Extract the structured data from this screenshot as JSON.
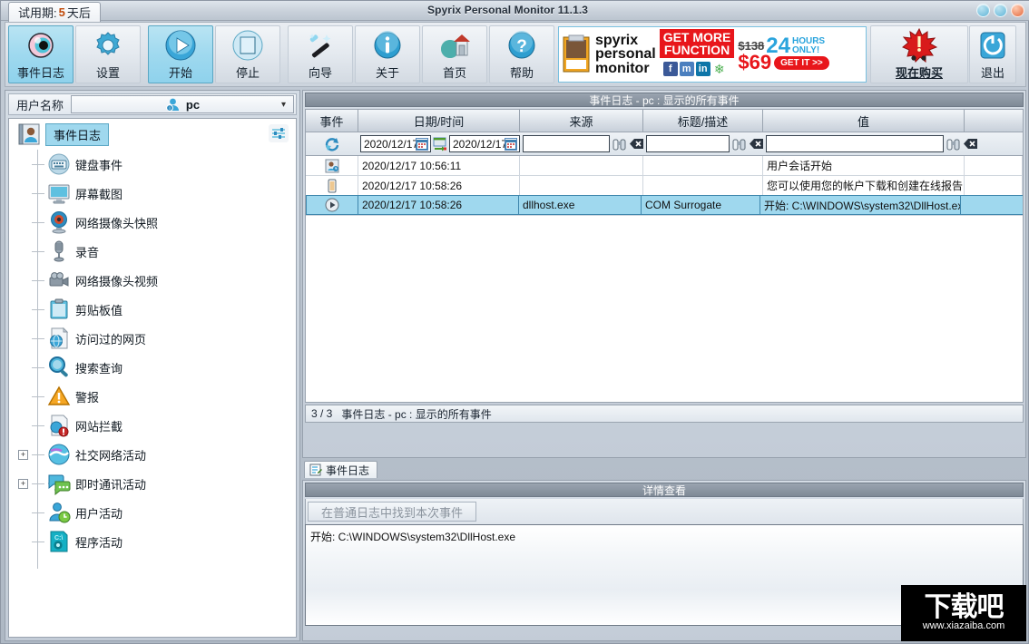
{
  "window": {
    "title": "Spyrix Personal Monitor 11.1.3",
    "trial_tab_prefix": "试用期:",
    "trial_days": "5",
    "trial_tab_suffix": "天后",
    "minimize_label": "–",
    "maximize_label": "□",
    "close_label": "×"
  },
  "toolbar": {
    "buttons": [
      {
        "label": "事件日志",
        "icon": "eye-icon",
        "selected": true
      },
      {
        "label": "设置",
        "icon": "gear-icon",
        "selected": false
      },
      {
        "label": "开始",
        "icon": "play-icon",
        "selected": true
      },
      {
        "label": "停止",
        "icon": "stop-icon",
        "selected": false
      },
      {
        "label": "向导",
        "icon": "wand-icon",
        "selected": false
      },
      {
        "label": "关于",
        "icon": "info-icon",
        "selected": false
      },
      {
        "label": "首页",
        "icon": "home-icon",
        "selected": false
      },
      {
        "label": "帮助",
        "icon": "question-icon",
        "selected": false
      }
    ],
    "buy": {
      "label": "现在购买",
      "icon": "starburst-alert-icon"
    },
    "exit": {
      "label": "退出",
      "icon": "power-icon"
    }
  },
  "banner": {
    "brand_line1": "spyrix",
    "brand_line2": "personal",
    "brand_line3": "monitor",
    "get_more_line1": "GET MORE",
    "get_more_line2": "FUNCTION",
    "old_price": "$138",
    "hours_number": "24",
    "hours_line1": "HOURS",
    "hours_line2": "ONLY!",
    "price": "$69",
    "cta": "GET IT >>",
    "socials": [
      "facebook-icon",
      "myspace-icon",
      "linkedin-icon",
      "icq-icon"
    ]
  },
  "sidebar": {
    "user_label": "用户名称",
    "user_value": "pc",
    "user_icon": "user-avatar-icon",
    "chevron": "▾",
    "filter_icon": "sliders-icon",
    "root": {
      "label": "事件日志",
      "icon": "logbook-icon"
    },
    "items": [
      {
        "label": "键盘事件",
        "icon": "keyboard-icon",
        "expandable": false
      },
      {
        "label": "屏幕截图",
        "icon": "monitor-icon",
        "expandable": false
      },
      {
        "label": "网络摄像头快照",
        "icon": "webcam-snapshot-icon",
        "expandable": false
      },
      {
        "label": "录音",
        "icon": "microphone-icon",
        "expandable": false
      },
      {
        "label": "网络摄像头视频",
        "icon": "camcorder-icon",
        "expandable": false
      },
      {
        "label": "剪贴板值",
        "icon": "clipboard-icon",
        "expandable": false
      },
      {
        "label": "访问过的网页",
        "icon": "web-page-icon",
        "expandable": false
      },
      {
        "label": "搜索查询",
        "icon": "magnifier-icon",
        "expandable": false
      },
      {
        "label": "警报",
        "icon": "warning-icon",
        "expandable": false
      },
      {
        "label": "网站拦截",
        "icon": "blocked-site-icon",
        "expandable": false
      },
      {
        "label": "社交网络活动",
        "icon": "social-network-icon",
        "expandable": true
      },
      {
        "label": "即时通讯活动",
        "icon": "instant-messenger-icon",
        "expandable": true
      },
      {
        "label": "用户活动",
        "icon": "user-activity-icon",
        "expandable": false
      },
      {
        "label": "程序活动",
        "icon": "program-activity-icon",
        "expandable": false
      }
    ],
    "expand_glyph": "+"
  },
  "grid": {
    "panel_title": "事件日志 - pc : 显示的所有事件",
    "columns": [
      "事件",
      "日期/时间",
      "来源",
      "标题/描述",
      "值",
      ""
    ],
    "filter": {
      "refresh_icon": "refresh-icon",
      "date_from": "2020/12/17",
      "date_to": "2020/12/17",
      "date_arrow_icon": "date-range-icon",
      "calendar_icon": "calendar-icon",
      "source_filter": "",
      "title_filter": "",
      "value_filter": "",
      "find_icon": "binoculars-icon",
      "clear_icon": "clear-filter-icon"
    },
    "rows": [
      {
        "icon": "user-session-icon",
        "datetime": "2020/12/17 10:56:11",
        "source": "",
        "title": "",
        "value": "用户会话开始",
        "selected": false
      },
      {
        "icon": "clipboard-row-icon",
        "datetime": "2020/12/17 10:58:26",
        "source": "",
        "title": "",
        "value": "您可以使用您的帐户下载和创建在线报告",
        "selected": false
      },
      {
        "icon": "program-run-icon",
        "datetime": "2020/12/17 10:58:26",
        "source": "dllhost.exe",
        "title": "COM Surrogate",
        "value": "开始: C:\\WINDOWS\\system32\\DllHost.exe",
        "selected": true
      }
    ],
    "status_count": "3 / 3",
    "status_text": "事件日志 - pc : 显示的所有事件"
  },
  "tabstrip": {
    "tabs": [
      {
        "label": "事件日志",
        "icon": "log-tab-icon",
        "active": true
      }
    ]
  },
  "detail": {
    "panel_title": "详情查看",
    "find_button": "在普通日志中找到本次事件",
    "content": "开始: C:\\WINDOWS\\system32\\DllHost.exe"
  },
  "watermark": {
    "text": "下载吧",
    "url": "www.xiazaiba.com"
  }
}
